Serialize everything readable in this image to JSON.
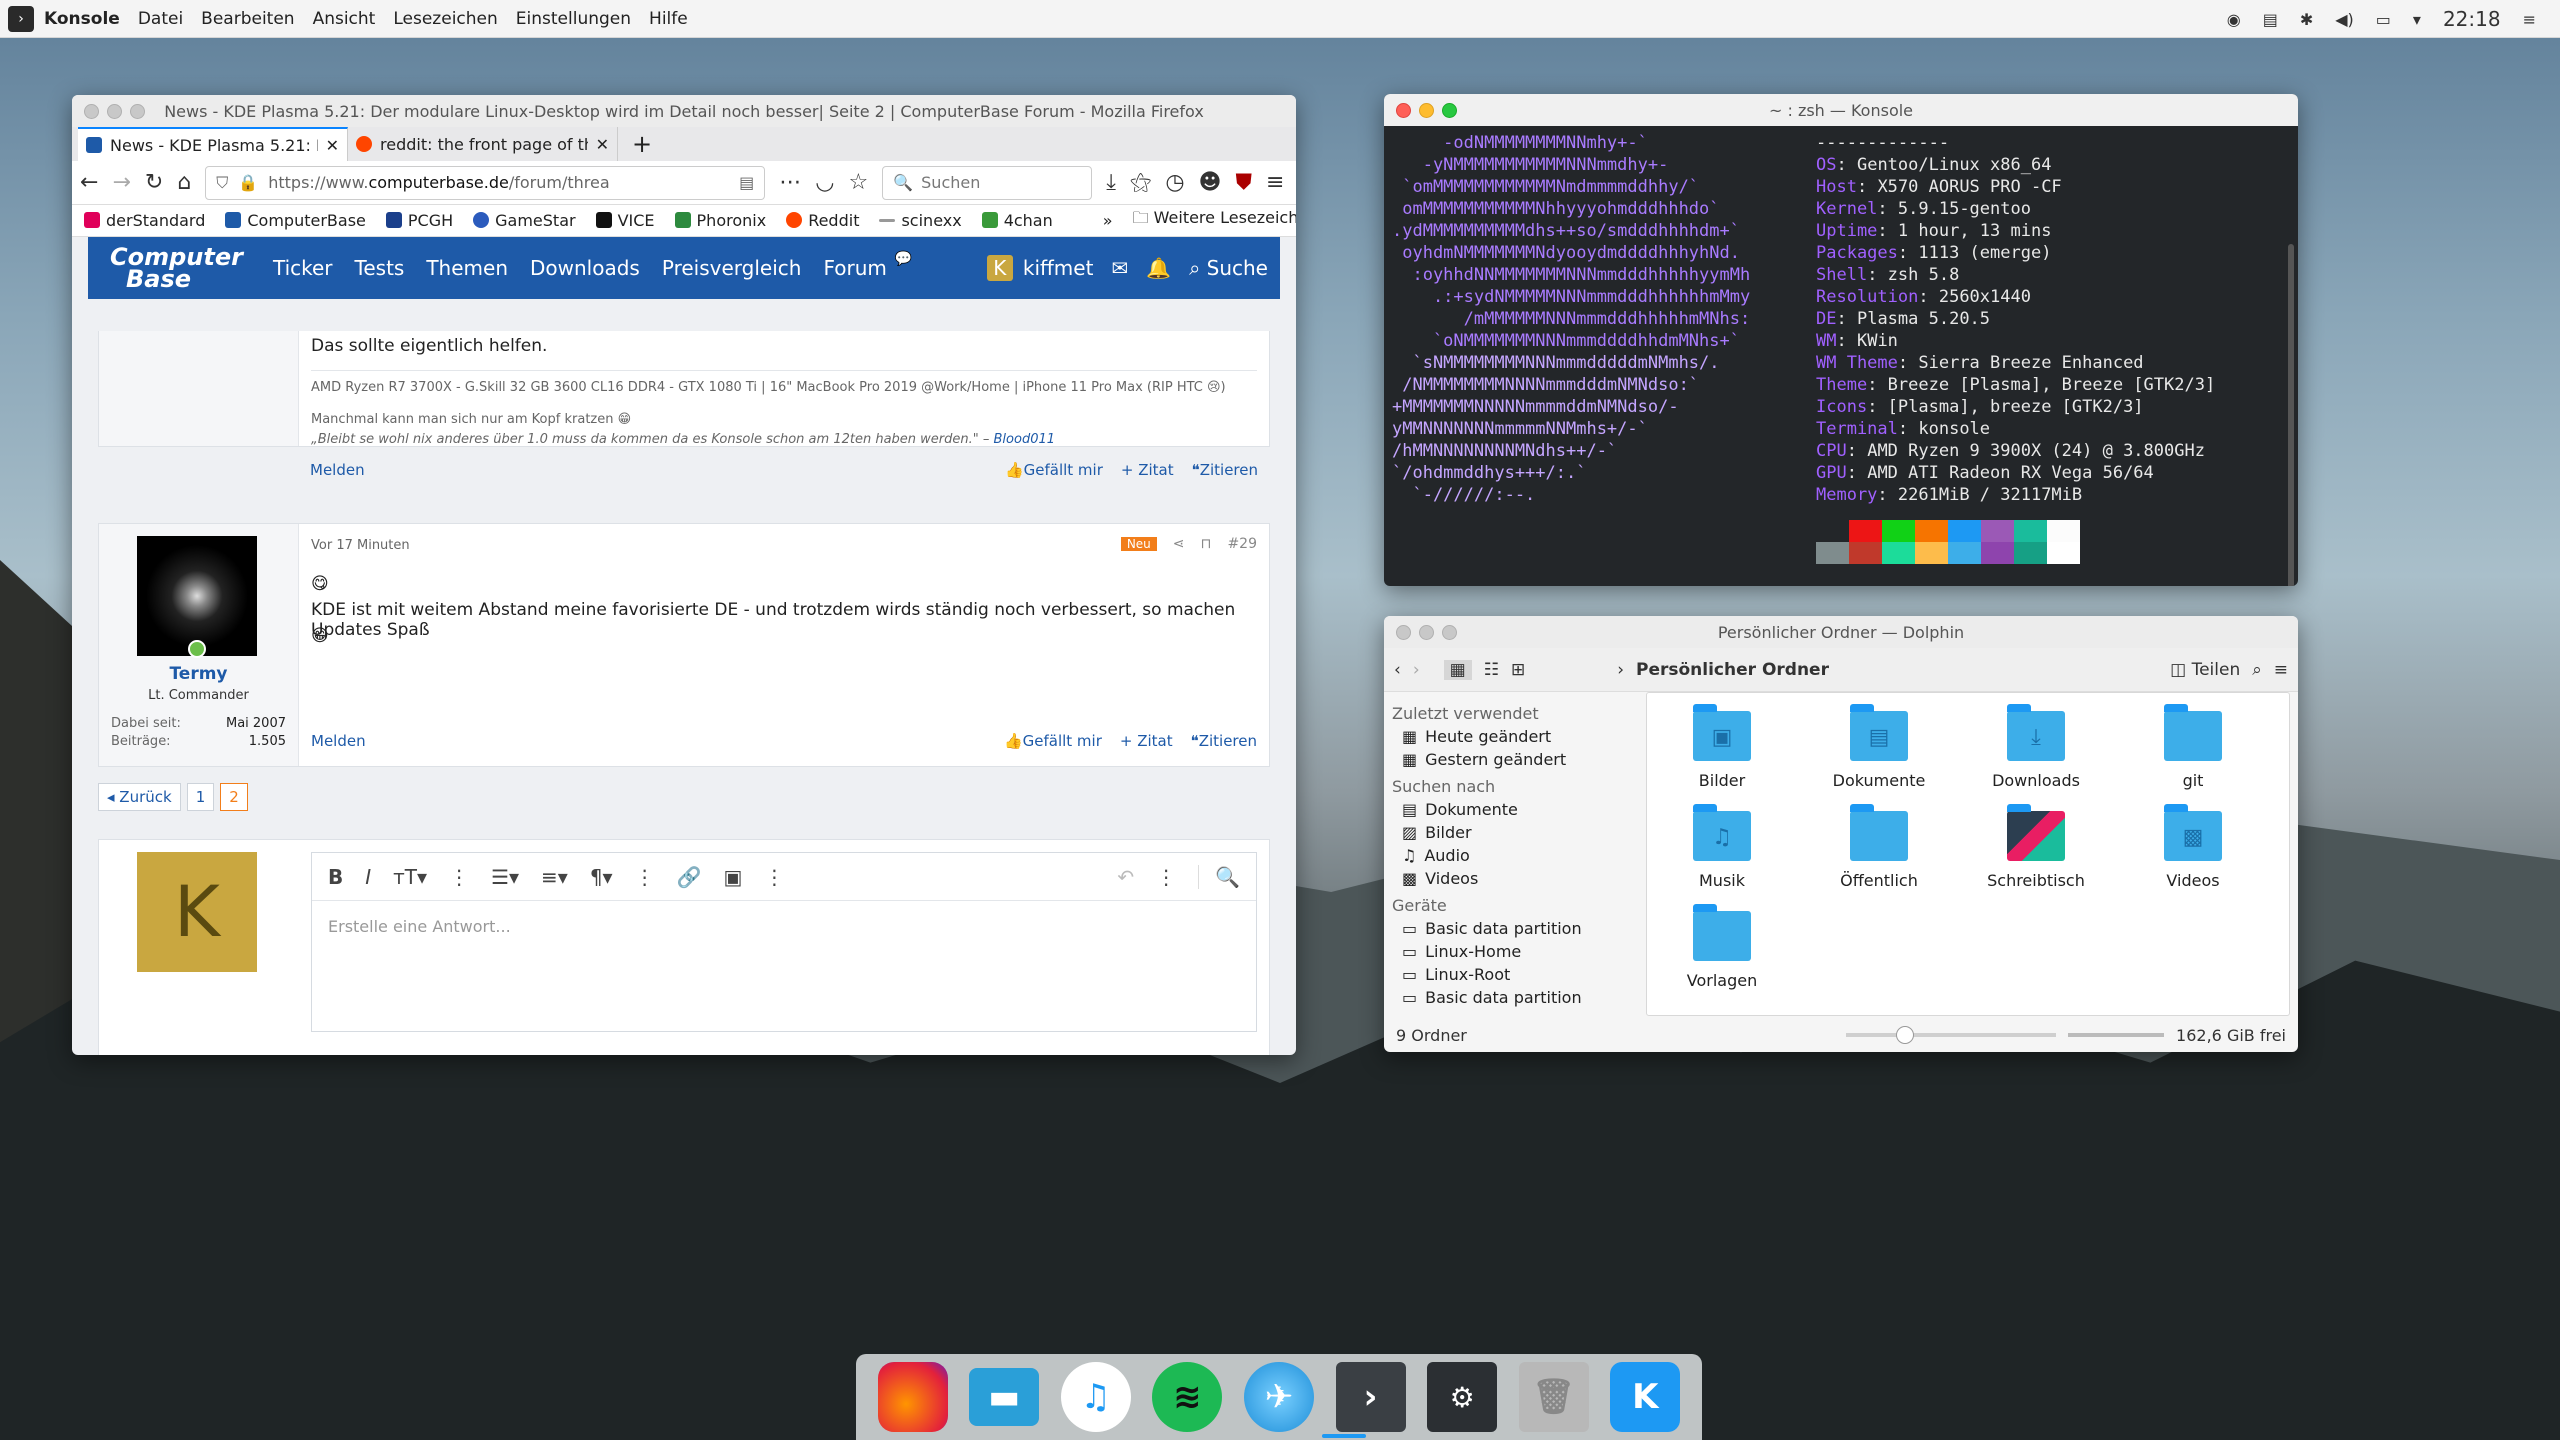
{
  "topbar": {
    "app": "Konsole",
    "menus": [
      "Datei",
      "Bearbeiten",
      "Ansicht",
      "Lesezeichen",
      "Einstellungen",
      "Hilfe"
    ],
    "clock": "22:18"
  },
  "firefox": {
    "title": "News - KDE Plasma 5.21: Der modulare Linux-Desktop wird im Detail noch besser| Seite 2 | ComputerBase Forum - Mozilla Firefox",
    "tabs": [
      "News - KDE Plasma 5.21: De",
      "reddit: the front page of the"
    ],
    "url_prefix": "https://www.",
    "url_domain": "computerbase.de",
    "url_path": "/forum/threa",
    "search_placeholder": "Suchen",
    "bookmarks": [
      "derStandard",
      "ComputerBase",
      "PCGH",
      "GameStar",
      "VICE",
      "Phoronix",
      "Reddit",
      "scinexx",
      "4chan"
    ],
    "bookmarks_more": "Weitere Lesezeichen",
    "site": {
      "logo_top": "Computer",
      "logo_bottom": "Base",
      "nav": [
        "Ticker",
        "Tests",
        "Themen",
        "Downloads",
        "Preisvergleich",
        "Forum"
      ],
      "user": "kiffmet",
      "user_initial": "K",
      "search": "Suche"
    },
    "post1": {
      "text": "Das sollte eigentlich helfen.",
      "signature": "AMD Ryzen R7 3700X - G.Skill 32 GB 3600 CL16 DDR4 - GTX 1080 Ti | 16\" MacBook Pro 2019 @Work/Home | iPhone 11 Pro Max (RIP HTC 😢)",
      "sig2": "Manchmal kann man sich nur am Kopf kratzen",
      "quote": "„Bleibt se wohl nix anderes über 1.0 muss da kommen da es Konsole schon am 12ten haben werden.\" –",
      "quote_author": "Blood011",
      "report": "Melden",
      "like": "Gefällt mir",
      "quote_btn": "+ Zitat",
      "cite": "Zitieren"
    },
    "post2": {
      "time": "Vor 17 Minuten",
      "badge": "Neu",
      "number": "#29",
      "author": "Termy",
      "rank": "Lt. Commander",
      "joined_label": "Dabei seit:",
      "joined": "Mai 2007",
      "posts_label": "Beiträge:",
      "posts": "1.505",
      "emoji": "😋",
      "text": "KDE ist mit weitem Abstand meine favorisierte DE - und trotzdem wirds ständig noch verbessert, so machen Updates Spaß",
      "emoji2": "😁",
      "report": "Melden",
      "like": "Gefällt mir",
      "quote_btn": "+ Zitat",
      "cite": "Zitieren"
    },
    "pagination": {
      "back": "◂ Zurück",
      "pages": [
        "1",
        "2"
      ]
    },
    "reply": {
      "avatar": "K",
      "placeholder": "Erstelle eine Antwort..."
    }
  },
  "konsole": {
    "title": "~ : zsh — Konsole",
    "logo_lines": [
      "     -odNMMMMMMMMNNmhy+-`",
      "   -yNMMMMMMMMMMMNNNmmdhy+-",
      " `omMMMMMMMMMMMMNmdmmmmddhhy/`",
      " omMMMMMMMMMMMNhhyyyohmdddhhhdo`",
      ".ydMMMMMMMMMMdhs++so/smdddhhhhdm+`",
      " oyhdmNMMMMMMMNdyooydmddddhhhyhNd.",
      "  :oyhhdNNMMMMMMMNNNmmdddhhhhhyymMh",
      "    .:+sydNMMMMMNNNmmmdddhhhhhhmMmy",
      "       /mMMMMMMNNNmmmdddhhhhhmMNhs:",
      "    `oNMMMMMMMNNNmmmddddhhdmMNhs+`",
      "  `sNMMMMMMMMNNNmmmdddddmNMmhs/.",
      " /NMMMMMMMMNNNNmmmdddmNMNdso:`",
      "+MMMMMMMNNNNNmmmmddmNMNdso/-",
      "yMMNNNNNNNmmmmmNNMmhs+/-`",
      "/hMMNNNNNNNNMNdhs++/-`",
      "`/ohdmmddhys+++/:.`",
      "  `-//////:--."
    ],
    "info": [
      {
        "k": "",
        "v": "-------------"
      },
      {
        "k": "OS",
        "v": "Gentoo/Linux x86_64"
      },
      {
        "k": "Host",
        "v": "X570 AORUS PRO -CF"
      },
      {
        "k": "Kernel",
        "v": "5.9.15-gentoo"
      },
      {
        "k": "Uptime",
        "v": "1 hour, 13 mins"
      },
      {
        "k": "Packages",
        "v": "1113 (emerge)"
      },
      {
        "k": "Shell",
        "v": "zsh 5.8"
      },
      {
        "k": "Resolution",
        "v": "2560x1440"
      },
      {
        "k": "DE",
        "v": "Plasma 5.20.5"
      },
      {
        "k": "WM",
        "v": "KWin"
      },
      {
        "k": "WM Theme",
        "v": "Sierra Breeze Enhanced"
      },
      {
        "k": "Theme",
        "v": "Breeze [Plasma], Breeze [GTK2/3]"
      },
      {
        "k": "Icons",
        "v": "[Plasma], breeze [GTK2/3]"
      },
      {
        "k": "Terminal",
        "v": "konsole"
      },
      {
        "k": "CPU",
        "v": "AMD Ryzen 9 3900X (24) @ 3.800GHz"
      },
      {
        "k": "GPU",
        "v": "AMD ATI Radeon RX Vega 56/64"
      },
      {
        "k": "Memory",
        "v": "2261MiB / 32117MiB"
      }
    ],
    "colors": [
      "#232629",
      "#ed1515",
      "#11d116",
      "#f67400",
      "#1d99f3",
      "#9b59b6",
      "#1abc9c",
      "#fcfcfc",
      "#7f8c8d",
      "#c0392b",
      "#1cdc9a",
      "#fdbc4b",
      "#3daee9",
      "#8e44ad",
      "#16a085",
      "#ffffff"
    ]
  },
  "dolphin": {
    "title": "Persönlicher Ordner — Dolphin",
    "breadcrumb": "Persönlicher Ordner",
    "split": "Teilen",
    "places": [
      {
        "header": "Zuletzt verwendet",
        "items": [
          "Heute geändert",
          "Gestern geändert"
        ]
      },
      {
        "header": "Suchen nach",
        "items": [
          "Dokumente",
          "Bilder",
          "Audio",
          "Videos"
        ]
      },
      {
        "header": "Geräte",
        "items": [
          "Basic data partition",
          "Linux-Home",
          "Linux-Root",
          "Basic data partition"
        ]
      }
    ],
    "folders": [
      "Bilder",
      "Dokumente",
      "Downloads",
      "git",
      "Musik",
      "Öffentlich",
      "Schreibtisch",
      "Videos",
      "Vorlagen"
    ],
    "status_count": "9 Ordner",
    "status_free": "162,6 GiB frei"
  },
  "dock": [
    "firefox-icon",
    "files-icon",
    "music-icon",
    "spotify-icon",
    "browser-icon",
    "terminal-icon",
    "settings-icon",
    "trash-icon",
    "kde-icon"
  ]
}
